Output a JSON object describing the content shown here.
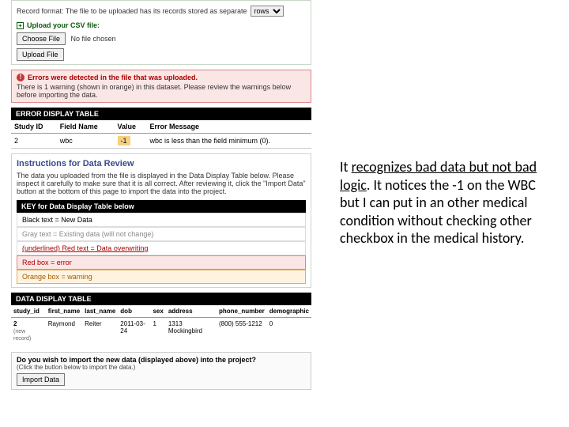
{
  "upload_panel": {
    "format_label": "Record format: The file to be uploaded has its records stored as separate",
    "format_option": "rows",
    "upload_label": "Upload your CSV file:",
    "choose_btn": "Choose File",
    "no_file": "No file chosen",
    "upload_btn": "Upload File"
  },
  "error_panel": {
    "title": "Errors were detected in the file that was uploaded.",
    "body": "There is 1 warning (shown in orange) in this dataset. Please review the warnings below before importing the data."
  },
  "error_table": {
    "title": "ERROR DISPLAY TABLE",
    "cols": [
      "Study ID",
      "Field Name",
      "Value",
      "Error Message"
    ],
    "row": {
      "study_id": "2",
      "field": "wbc",
      "value": "-1",
      "msg": "wbc is less than the field minimum (0)."
    }
  },
  "instructions": {
    "title": "Instructions for Data Review",
    "body": "The data you uploaded from the file is displayed in the Data Display Table below. Please inspect it carefully to make sure that it is all correct. After reviewing it, click the \"Import Data\" button at the bottom of this page to import the data into the project."
  },
  "key": {
    "title": "KEY for Data Display Table below",
    "rows": [
      "Black text = New Data",
      "Gray text = Existing data (will not change)",
      "(underlined) Red text = Data overwriting",
      "Red box = error",
      "Orange box = warning"
    ]
  },
  "data_table": {
    "title": "DATA DISPLAY TABLE",
    "cols": [
      "study_id",
      "first_name",
      "last_name",
      "dob",
      "sex",
      "address",
      "phone_number",
      "demographic"
    ],
    "row": {
      "study_id": "2",
      "sub": "(new record)",
      "first_name": "Raymond",
      "last_name": "Reiter",
      "dob": "2011-03-24",
      "sex": "1",
      "address": "1313 Mockingbird",
      "phone": "(800) 555-1212",
      "demo": "0"
    }
  },
  "import": {
    "title": "Do you wish to import the new data (displayed above) into the project?",
    "sub": "(Click the button below to import the data.)",
    "btn": "Import Data"
  },
  "annotation": {
    "t1": "It ",
    "t2": "recognizes bad data but not bad logic",
    "t3": ".  It notices the -1 on the WBC but I can put in an other medical condition without checking other checkbox in the medical history."
  }
}
